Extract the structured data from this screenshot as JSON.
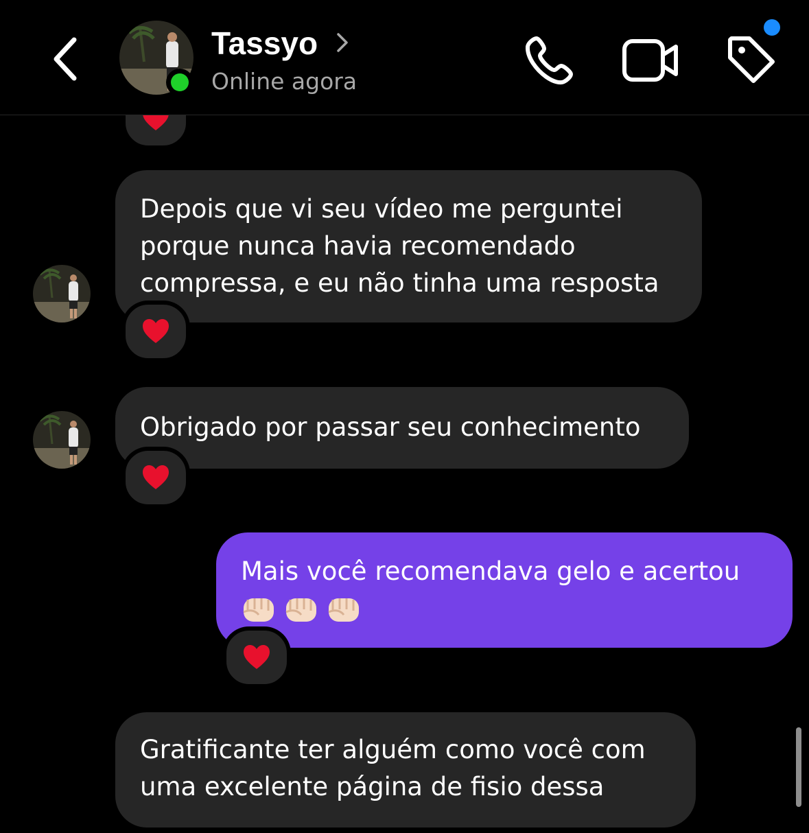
{
  "header": {
    "contact_name": "Tassyo",
    "status": "Online agora",
    "icons": {
      "back": "chevron-left-icon",
      "call": "phone-icon",
      "video": "video-camera-icon",
      "tag": "tag-icon"
    },
    "colors": {
      "online": "#1fd02a",
      "notification": "#1a8cff"
    }
  },
  "messages": [
    {
      "direction": "incoming",
      "lines": [
        "Depois que vi seu vídeo me perguntei",
        "porque nunca havia recomendado",
        "compressa, e eu não tinha uma resposta"
      ],
      "reaction": "heart"
    },
    {
      "direction": "incoming",
      "lines": [
        "Obrigado por passar seu conhecimento"
      ],
      "reaction": "heart"
    },
    {
      "direction": "outgoing",
      "lines": [
        "Mais você recomendava gelo e acertou"
      ],
      "emojis": [
        "fist",
        "fist",
        "fist"
      ],
      "reaction": "heart"
    },
    {
      "direction": "incoming",
      "lines": [
        "Gratificante ter alguém como você com",
        "uma excelente página de fisio dessa"
      ]
    }
  ],
  "colors": {
    "incoming_bubble": "#262626",
    "outgoing_bubble": "#7541e8",
    "background": "#000000",
    "reaction_heart": "#e8112d"
  }
}
